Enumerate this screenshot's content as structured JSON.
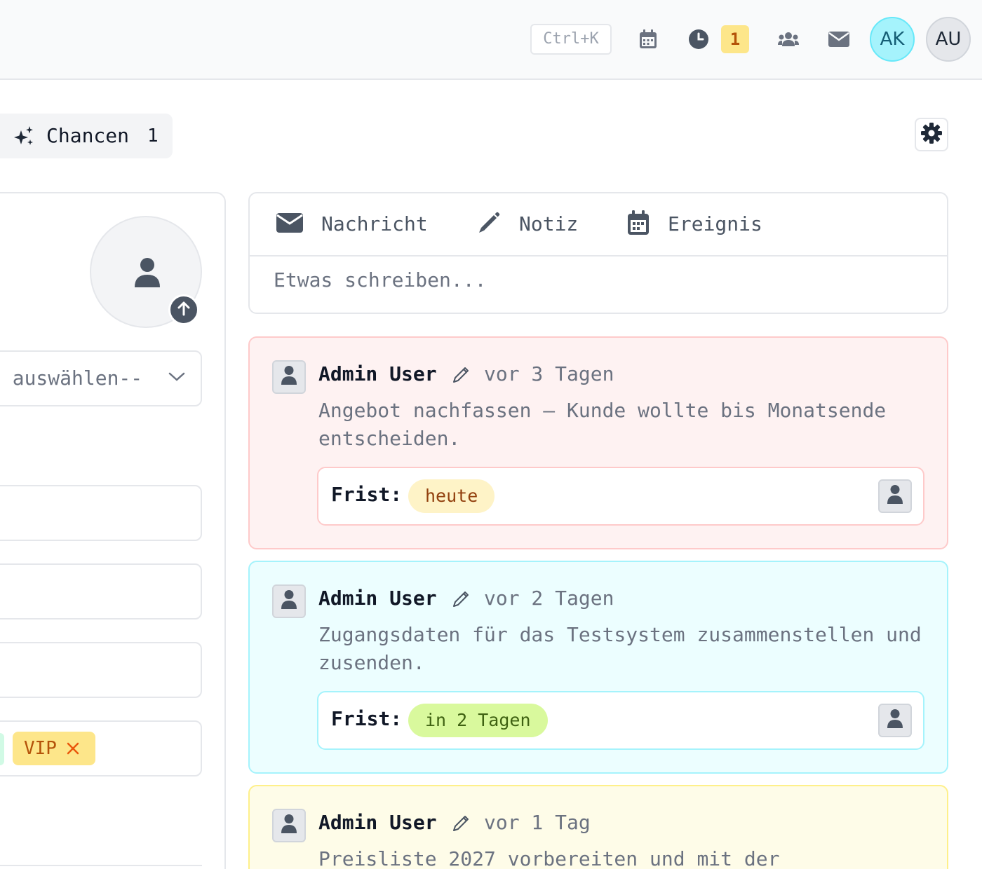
{
  "topbar": {
    "shortcut": "Ctrl+K",
    "icons": [
      "calendar-icon",
      "clock-icon",
      "users-icon",
      "mail-icon"
    ],
    "reminder_count": "1",
    "avatars": [
      {
        "initials": "AK",
        "color": "#a5f3fc"
      },
      {
        "initials": "AU",
        "color": "#e5e7eb"
      }
    ]
  },
  "tabs": {
    "chancen_label": "Chancen",
    "chancen_count": "1"
  },
  "contact": {
    "select_text": "e auswählen--",
    "tags": [
      {
        "label": "VIP",
        "color": "#fde68a"
      }
    ]
  },
  "composer": {
    "tabs": [
      {
        "label": "Nachricht",
        "icon": "mail-icon"
      },
      {
        "label": "Notiz",
        "icon": "pencil-icon"
      },
      {
        "label": "Ereignis",
        "icon": "calendar-icon"
      }
    ],
    "placeholder": "Etwas schreiben..."
  },
  "activities": [
    {
      "author": "Admin User",
      "time": "vor 3 Tagen",
      "text": "Angebot nachfassen – Kunde wollte bis Monatsende entscheiden.",
      "due_label": "Frist:",
      "due": "heute",
      "bg": "#fef2f2",
      "border": "#fecaca",
      "pill_bg": "#fef3c7",
      "pill_fg": "#92400e"
    },
    {
      "author": "Admin User",
      "time": "vor 2 Tagen",
      "text": "Zugangsdaten für das Testsystem zusammenstellen und zusenden.",
      "due_label": "Frist:",
      "due": "in 2 Tagen",
      "bg": "#ecfeff",
      "border": "#a5f3fc",
      "pill_bg": "#d9f99d",
      "pill_fg": "#3f6212"
    },
    {
      "author": "Admin User",
      "time": "vor 1 Tag",
      "text": "Preisliste 2027 vorbereiten und mit der",
      "bg": "#fefce8",
      "border": "#fef08a"
    }
  ]
}
